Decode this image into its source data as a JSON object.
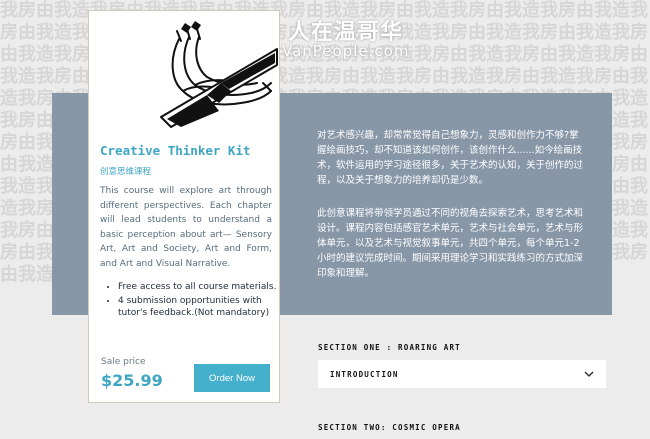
{
  "background_text": "我房由我造我房由我造我房由我造我房由我造我房由我造我房由我造我房由我造我房由我造我房由我造我房由我造我房由我造我房由我造我房由我造我房由我造我房由我造我房由我造我房由我造我房由我造我房由我造我房由我造我房由我造我房由我造我房由我造我房由我造我房由我造我房由我造我房由我造我房由我造我房由我造我房由我造我房由我造我房由我造我房由我造我房由我造我房由我造我房由我造我房由我造我房由我造我房由我造我房由我造我房由我造我房由我造我房由我造我房由我造我房由我造我房由我造我房由我造我房由我造我房由我造我房由我造我房由我造我房由我造我房由我造我房由我造我房由我造我房由我造我房由我造我房由我造我房由我造我房由我造我房由我造我房由我造我房由我造我房由我造我房由我造我房由我造我房由我造我房由我造我房由我造我房由我造我房由我造我房由我造我房由我造我房由我造我房由我造我房由我造我房由我造我房由我造我房由我造我房由我造我房由我造我房由我造我房由我造我房由我造我房由我造我房由我造我房由我造我房由我造",
  "watermark": {
    "cn": "人在温哥华",
    "url": "VanPeople.com"
  },
  "card": {
    "title": "Creative Thinker Kit",
    "subtitle": "创意思维课程",
    "description": "This course will explore art through different perspectives. Each chapter will lead students to understand a basic perception about art— Sensory Art, Art and Society, Art and Form, and Art and Visual Narrative.",
    "features": [
      "Free access to all course materials.",
      "4 submission opportunities with tutor's feedback.(Not mandatory)"
    ],
    "sale_label": "Sale price",
    "price": "$25.99",
    "order_button": "Order Now"
  },
  "panel": {
    "paragraph1": "对艺术感兴趣，却常常觉得自己想象力，灵感和创作力不够?掌握绘画技巧，却不知道该如何创作，该创作什么......如今绘画技术，软件运用的学习途径很多，关于艺术的认知，关于创作的过程，以及关于想象力的培养却仍是少数。",
    "paragraph2": "此创意课程将带领学员通过不同的视角去探索艺术，思考艺术和设计。课程内容包括感官艺术单元，艺术与社会单元，艺术与形体单元，以及艺术与视觉叙事单元，共四个单元，每个单元1-2小时的建议完成时间。期间采用理论学习和实践练习的方式加深印象和理解。"
  },
  "sections": {
    "section1_label": "SECTION ONE : ROARING ART",
    "accordion_title": "INTRODUCTION",
    "section2_label": "SECTION TWO: COSMIC OPERA"
  },
  "colors": {
    "accent": "#3ea6c2",
    "panel": "#8897a8",
    "button": "#45b0cc"
  }
}
